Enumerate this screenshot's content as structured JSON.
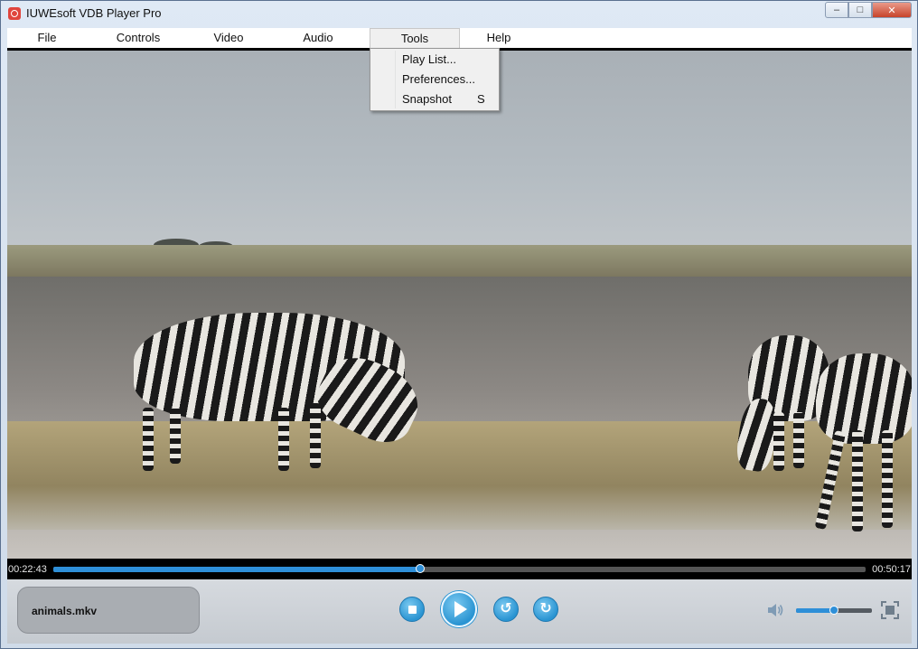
{
  "window": {
    "title": "IUWEsoft VDB Player Pro"
  },
  "menu": {
    "items": [
      "File",
      "Controls",
      "Video",
      "Audio",
      "Tools",
      "Help"
    ],
    "open": "Tools",
    "dropdown": [
      {
        "label": "Play List...",
        "shortcut": ""
      },
      {
        "label": "Preferences...",
        "shortcut": ""
      },
      {
        "label": "Snapshot",
        "shortcut": "S"
      }
    ]
  },
  "playback": {
    "elapsed": "00:22:43",
    "total": "00:50:17",
    "progress_fraction": 0.452,
    "file_name": "animals.mkv",
    "volume_fraction": 0.5
  },
  "icons": {
    "stop": "stop-icon",
    "play": "play-icon",
    "rewind": "rewind-icon",
    "forward": "forward-icon",
    "volume": "speaker-icon",
    "fullscreen": "fullscreen-icon"
  },
  "colors": {
    "accent": "#2e8fd8",
    "close_button": "#c7432a"
  }
}
